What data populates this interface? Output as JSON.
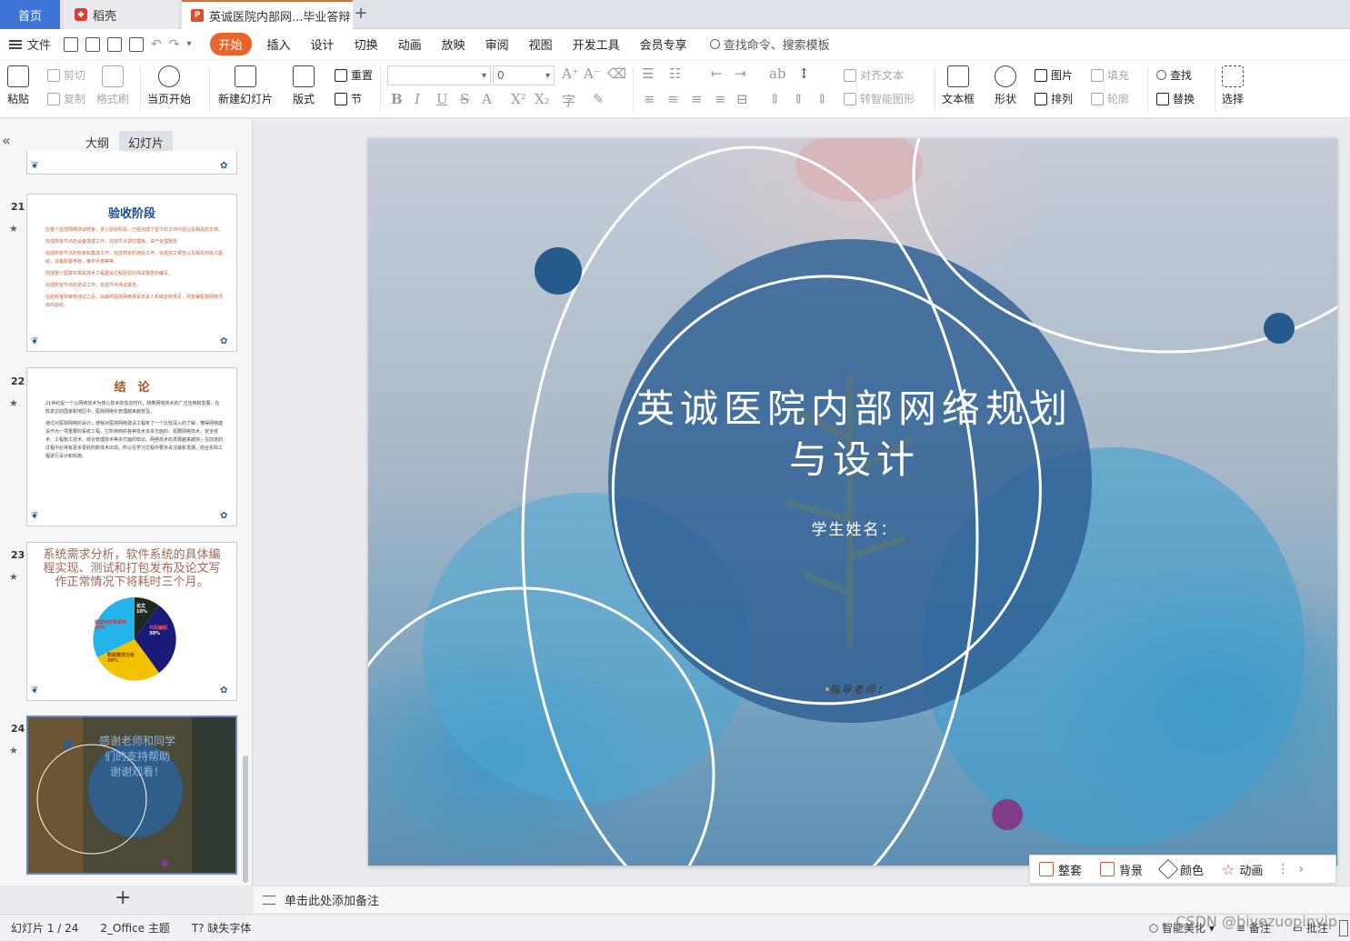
{
  "tabs": {
    "home": "首页",
    "docer": "稻壳",
    "doc": "英诚医院内部网...毕业答辩pp",
    "add": "+"
  },
  "menubar": {
    "file": "文件",
    "items": [
      "开始",
      "插入",
      "设计",
      "切换",
      "动画",
      "放映",
      "审阅",
      "视图",
      "开发工具",
      "会员专享"
    ],
    "search": "查找命令、搜索模板"
  },
  "ribbon": {
    "paste": "粘贴",
    "cut": "剪切",
    "copy": "复制",
    "format_painter": "格式刷",
    "from_current": "当页开始",
    "new_slide": "新建幻灯片",
    "layout": "版式",
    "reset": "重置",
    "section": "节",
    "font_size": "0",
    "align_text": "对齐文本",
    "smart_art": "转智能图形",
    "textbox": "文本框",
    "shape": "形状",
    "picture": "图片",
    "arrange": "排列",
    "fill": "填充",
    "outline": "轮廓",
    "find": "查找",
    "replace": "替换",
    "select": "选择"
  },
  "panel": {
    "tab_outline": "大纲",
    "tab_slides": "幻灯片",
    "slides": [
      {
        "num": "21",
        "title": "验收阶段",
        "lines": [
          "在整个监控网络测试结束，进入验收阶段，已经完成了留下的工作内容以及相关的文档。",
          "完成所有节点的设备搭建工作，完成节点调控模板，资产处理报告",
          "完成所有节点的安装和集成工作，完成规定的通信工作，完成完工报告以及相关的竣工图纸，设备配置参数，维护手册等等。",
          "完成整个医院并相关技术工程建设过程验收的测试报告的编写。",
          "完成所有节点的调试工作，完成节点测试报告。",
          "在验收答辩审核通过之后，由最终医院网络相关负责人和或验收意见，并签署医院网络项目的验收。"
        ]
      },
      {
        "num": "22",
        "title": "结　论",
        "lines": [
          "21世纪是一个以网络技术为核心技术的信息时代，随着网络技术的广泛应用和发展，在较发达的国家和地区中，医院网络化管理越来越普及。",
          "通过对医院网络的设计，使我对医院网络建设工程有了一个比较深入的了解，懂得网络建设作为一项重要的系统工程，它所用到的各种技术多多方面的，需要网络技术、安全技术、工程施工技术、综合管理技术等多方面的知识。网络技术的发展越来越快，在前途的过程中必将有更多更好的新技术出现，所以在学习过程中要多关注最新发展，结合实际工程进行设计和实施。"
        ]
      },
      {
        "num": "23",
        "text": "系统需求分析，软件系统的具体编程实现、测试和打包发布及论文写作正常情况下将耗时三个月。",
        "pie_labels": [
          {
            "text": "论文",
            "pct": "10%"
          },
          {
            "text": "代码编程",
            "pct": "30%"
          },
          {
            "text": "数据需求分析",
            "pct": "30%"
          },
          {
            "text": "测试与打包发布",
            "pct": "30%"
          }
        ]
      },
      {
        "num": "24",
        "lines": [
          "感谢老师和同学",
          "们的支持帮助",
          "谢谢观看！"
        ]
      }
    ],
    "add_slide": "+"
  },
  "slide": {
    "title": "英诚医院内部网络规划与设计",
    "student": "学生姓名：",
    "advisor": "指导老师：",
    "colors": {
      "main_circle": "#2d5f94",
      "dot_blue": "#255a8c",
      "dot_purple": "#7e3d86"
    }
  },
  "floatbar": {
    "items": [
      "整套",
      "背景",
      "颜色",
      "动画"
    ],
    "more": "⋮",
    "next": "›"
  },
  "notes": "单击此处添加备注",
  "status": {
    "slide_index": "幻灯片 1 / 24",
    "theme": "2_Office 主题",
    "missing_font": "缺失字体",
    "beautify": "智能美化",
    "notes_btn": "备注",
    "comments_btn": "批注"
  },
  "watermark": "CSDN @biyezuopinvip"
}
